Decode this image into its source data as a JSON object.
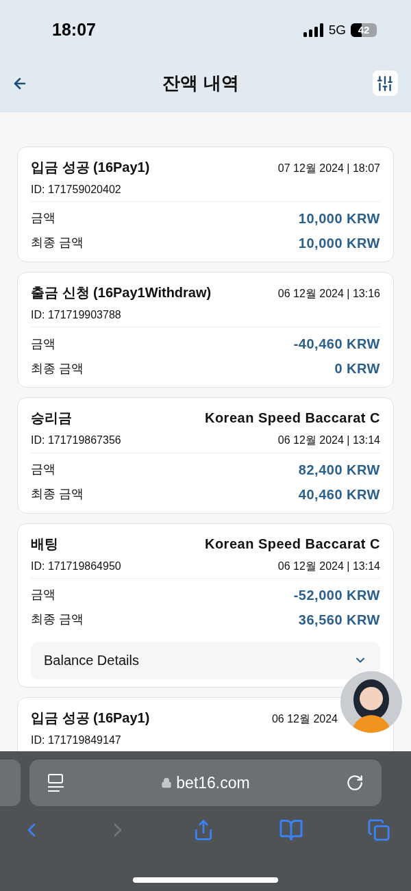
{
  "status_bar": {
    "time": "18:07",
    "network": "5G",
    "battery": "42"
  },
  "header": {
    "title": "잔액 내역"
  },
  "transactions": [
    {
      "title": "입금 성공 (16Pay1)",
      "top_right": "07 12월 2024 | 18:07",
      "id": "ID: 171759020402",
      "amount_label": "금액",
      "amount": "10,000 KRW",
      "final_label": "최종 금액",
      "final": "10,000 KRW"
    },
    {
      "title": "출금 신청 (16Pay1Withdraw)",
      "top_right": "06 12월 2024 | 13:16",
      "id": "ID: 171719903788",
      "amount_label": "금액",
      "amount": "-40,460 KRW",
      "final_label": "최종 금액",
      "final": "0 KRW"
    },
    {
      "title": "승리금",
      "top_right": "Korean Speed Baccarat C",
      "id": "ID: 171719867356",
      "id_right": "06 12월 2024 | 13:14",
      "amount_label": "금액",
      "amount": "82,400 KRW",
      "final_label": "최종 금액",
      "final": "40,460 KRW"
    },
    {
      "title": "배팅",
      "top_right": "Korean Speed Baccarat C",
      "id": "ID: 171719864950",
      "id_right": "06 12월 2024 | 13:14",
      "amount_label": "금액",
      "amount": "-52,000 KRW",
      "final_label": "최종 금액",
      "final": "36,560 KRW",
      "details": {
        "label": "Balance Details",
        "expanded": false
      }
    },
    {
      "title": "입금 성공 (16Pay1)",
      "top_right": "06 12월 2024",
      "id": "ID: 171719849147"
    }
  ],
  "browser": {
    "url": "bet16.com"
  }
}
